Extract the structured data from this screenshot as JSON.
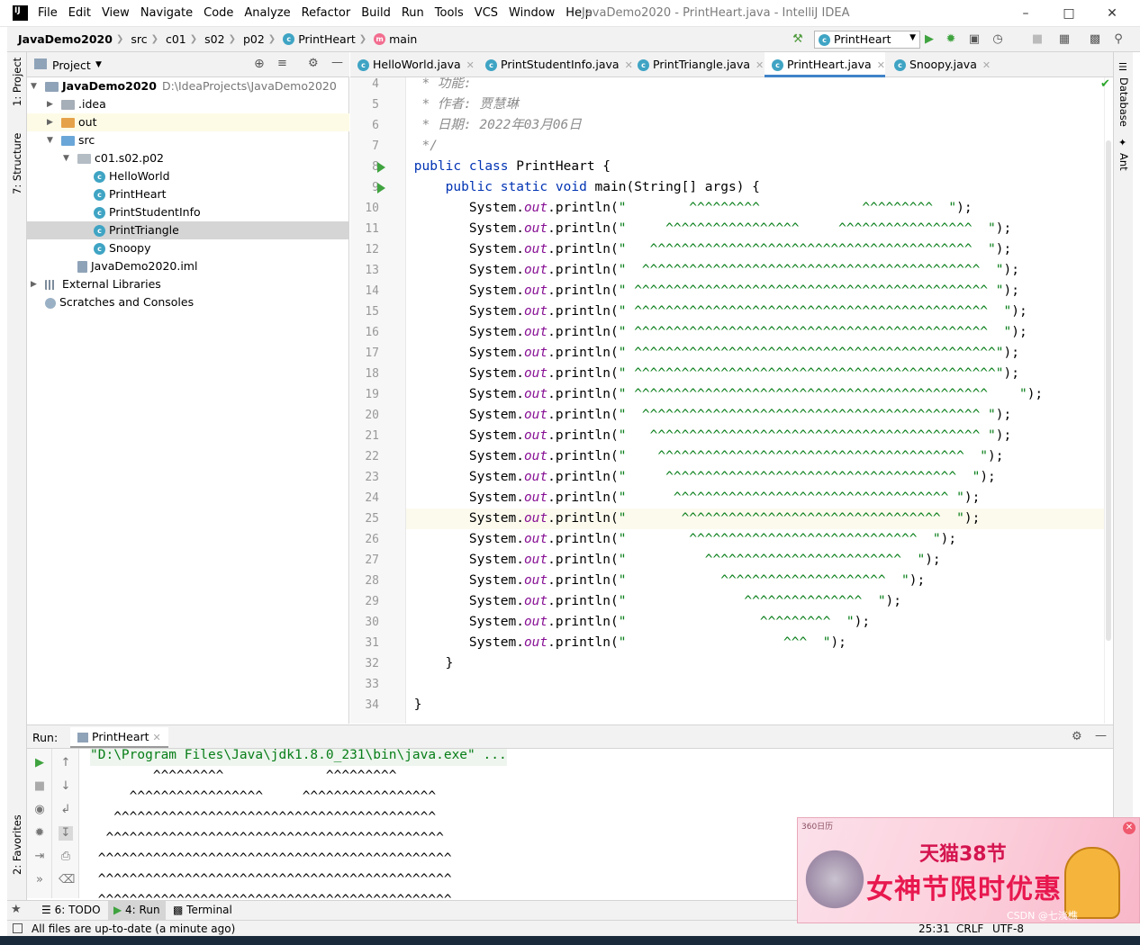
{
  "titlebar": {
    "logo": "IJ",
    "menu": [
      "File",
      "Edit",
      "View",
      "Navigate",
      "Code",
      "Analyze",
      "Refactor",
      "Build",
      "Run",
      "Tools",
      "VCS",
      "Window",
      "Help"
    ],
    "window_title": "JavaDemo2020 - PrintHeart.java - IntelliJ IDEA",
    "controls": [
      "minimize-icon",
      "maximize-icon",
      "close-icon"
    ]
  },
  "navbar": {
    "breadcrumb": [
      "JavaDemo2020",
      "src",
      "c01",
      "s02",
      "p02",
      "PrintHeart",
      "main"
    ],
    "run_config": "PrintHeart"
  },
  "left_strip": {
    "project_tab": "1: Project",
    "structure_tab": "7: Structure",
    "favorites_tab": "2: Favorites"
  },
  "right_strip": {
    "database_tab": "Database",
    "ant_tab": "Ant"
  },
  "project_panel": {
    "title": "Project",
    "tree": [
      {
        "label": "JavaDemo2020",
        "path": "D:\\IdeaProjects\\JavaDemo2020",
        "icon": "module-folder-icon",
        "depth": 0,
        "expanded": true
      },
      {
        "label": ".idea",
        "icon": "folder-icon",
        "depth": 1,
        "expanded": false
      },
      {
        "label": "out",
        "icon": "excluded-folder-icon",
        "depth": 1,
        "expanded": false
      },
      {
        "label": "src",
        "icon": "source-folder-icon",
        "depth": 1,
        "expanded": true
      },
      {
        "label": "c01.s02.p02",
        "icon": "package-icon",
        "depth": 2,
        "expanded": true
      },
      {
        "label": "HelloWorld",
        "icon": "class-icon",
        "depth": 3
      },
      {
        "label": "PrintHeart",
        "icon": "class-icon",
        "depth": 3
      },
      {
        "label": "PrintStudentInfo",
        "icon": "class-icon",
        "depth": 3
      },
      {
        "label": "PrintTriangle",
        "icon": "class-icon",
        "depth": 3,
        "selected": true
      },
      {
        "label": "Snoopy",
        "icon": "class-icon",
        "depth": 3
      },
      {
        "label": "JavaDemo2020.iml",
        "icon": "iml-file-icon",
        "depth": 2
      },
      {
        "label": "External Libraries",
        "icon": "library-icon",
        "depth": 0,
        "expanded": false
      },
      {
        "label": "Scratches and Consoles",
        "icon": "scratches-icon",
        "depth": 0
      }
    ]
  },
  "editor_tabs": [
    "HelloWorld.java",
    "PrintStudentInfo.java",
    "PrintTriangle.java",
    "PrintHeart.java",
    "Snoopy.java"
  ],
  "active_tab": "PrintHeart.java",
  "code": {
    "current_line": 25,
    "lines": [
      {
        "n": "4",
        "text": " * 功能:"
      },
      {
        "n": "5",
        "text": " * 作者: 贾慧琳"
      },
      {
        "n": "6",
        "text": " * 日期: 2022年03月06日"
      },
      {
        "n": "7",
        "text": " */"
      },
      {
        "n": "8",
        "text": "public class PrintHeart {"
      },
      {
        "n": "9",
        "text": "    public static void main(String[] args) {"
      },
      {
        "n": "10",
        "s": "        ^^^^^^^^^             ^^^^^^^^^  "
      },
      {
        "n": "11",
        "s": "     ^^^^^^^^^^^^^^^^^     ^^^^^^^^^^^^^^^^^  "
      },
      {
        "n": "12",
        "s": "   ^^^^^^^^^^^^^^^^^^^^^^^^^^^^^^^^^^^^^^^^^  "
      },
      {
        "n": "13",
        "s": "  ^^^^^^^^^^^^^^^^^^^^^^^^^^^^^^^^^^^^^^^^^^^  "
      },
      {
        "n": "14",
        "s": " ^^^^^^^^^^^^^^^^^^^^^^^^^^^^^^^^^^^^^^^^^^^^^ "
      },
      {
        "n": "15",
        "s": " ^^^^^^^^^^^^^^^^^^^^^^^^^^^^^^^^^^^^^^^^^^^^^  "
      },
      {
        "n": "16",
        "s": " ^^^^^^^^^^^^^^^^^^^^^^^^^^^^^^^^^^^^^^^^^^^^^  "
      },
      {
        "n": "17",
        "s": " ^^^^^^^^^^^^^^^^^^^^^^^^^^^^^^^^^^^^^^^^^^^^^^"
      },
      {
        "n": "18",
        "s": " ^^^^^^^^^^^^^^^^^^^^^^^^^^^^^^^^^^^^^^^^^^^^^^"
      },
      {
        "n": "19",
        "s": " ^^^^^^^^^^^^^^^^^^^^^^^^^^^^^^^^^^^^^^^^^^^^^    "
      },
      {
        "n": "20",
        "s": "  ^^^^^^^^^^^^^^^^^^^^^^^^^^^^^^^^^^^^^^^^^^^ "
      },
      {
        "n": "21",
        "s": "   ^^^^^^^^^^^^^^^^^^^^^^^^^^^^^^^^^^^^^^^^^^ "
      },
      {
        "n": "22",
        "s": "    ^^^^^^^^^^^^^^^^^^^^^^^^^^^^^^^^^^^^^^^  "
      },
      {
        "n": "23",
        "s": "     ^^^^^^^^^^^^^^^^^^^^^^^^^^^^^^^^^^^^^  "
      },
      {
        "n": "24",
        "s": "      ^^^^^^^^^^^^^^^^^^^^^^^^^^^^^^^^^^^ "
      },
      {
        "n": "25",
        "s": "       ^^^^^^^^^^^^^^^^^^^^^^^^^^^^^^^^^  "
      },
      {
        "n": "26",
        "s": "        ^^^^^^^^^^^^^^^^^^^^^^^^^^^^^  "
      },
      {
        "n": "27",
        "s": "          ^^^^^^^^^^^^^^^^^^^^^^^^^  "
      },
      {
        "n": "28",
        "s": "            ^^^^^^^^^^^^^^^^^^^^^  "
      },
      {
        "n": "29",
        "s": "               ^^^^^^^^^^^^^^^  "
      },
      {
        "n": "30",
        "s": "                 ^^^^^^^^^  "
      },
      {
        "n": "31",
        "s": "                    ^^^  "
      },
      {
        "n": "32",
        "text": "    }"
      },
      {
        "n": "33",
        "text": ""
      },
      {
        "n": "34",
        "text": "}"
      }
    ]
  },
  "run_panel": {
    "label": "Run:",
    "tab": "PrintHeart",
    "command": "\"D:\\Program Files\\Java\\jdk1.8.0_231\\bin\\java.exe\" ...",
    "output": [
      "        ^^^^^^^^^             ^^^^^^^^^  ",
      "     ^^^^^^^^^^^^^^^^^     ^^^^^^^^^^^^^^^^^  ",
      "   ^^^^^^^^^^^^^^^^^^^^^^^^^^^^^^^^^^^^^^^^^  ",
      "  ^^^^^^^^^^^^^^^^^^^^^^^^^^^^^^^^^^^^^^^^^^^  ",
      " ^^^^^^^^^^^^^^^^^^^^^^^^^^^^^^^^^^^^^^^^^^^^^ ",
      " ^^^^^^^^^^^^^^^^^^^^^^^^^^^^^^^^^^^^^^^^^^^^^  ",
      " ^^^^^^^^^^^^^^^^^^^^^^^^^^^^^^^^^^^^^^^^^^^^^  "
    ]
  },
  "bottom_tabs": [
    "6: TODO",
    "4: Run",
    "Terminal"
  ],
  "status": {
    "message": "All files are up-to-date (a minute ago)",
    "position": "25:31",
    "line_sep": "CRLF",
    "encoding": "UTF-8"
  },
  "ad": {
    "source": "360日历",
    "headline": "天猫38节",
    "slogan": "女神节限时优惠",
    "watermark": "CSDN @七淡樵"
  },
  "colors": {
    "accent": "#4083c9",
    "keyword": "#0033b3",
    "string": "#067d17",
    "field": "#871094",
    "comment": "#8c8c8c",
    "run_green": "#3fa33f"
  }
}
